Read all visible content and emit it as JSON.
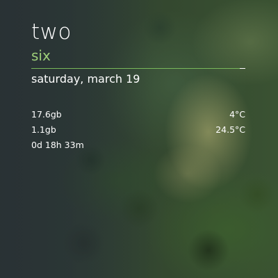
{
  "widget": {
    "title": "two",
    "subtitle": "six",
    "date": "saturday, march 19",
    "accent_color": "#9fd07a",
    "stats": [
      {
        "left": "17.6gb",
        "right": "4°C"
      },
      {
        "left": "1.1gb",
        "right": "24.5°C"
      },
      {
        "left": "0d 18h 33m",
        "right": ""
      }
    ]
  },
  "wallpaper": {
    "description_name": "forest-wallpaper"
  }
}
